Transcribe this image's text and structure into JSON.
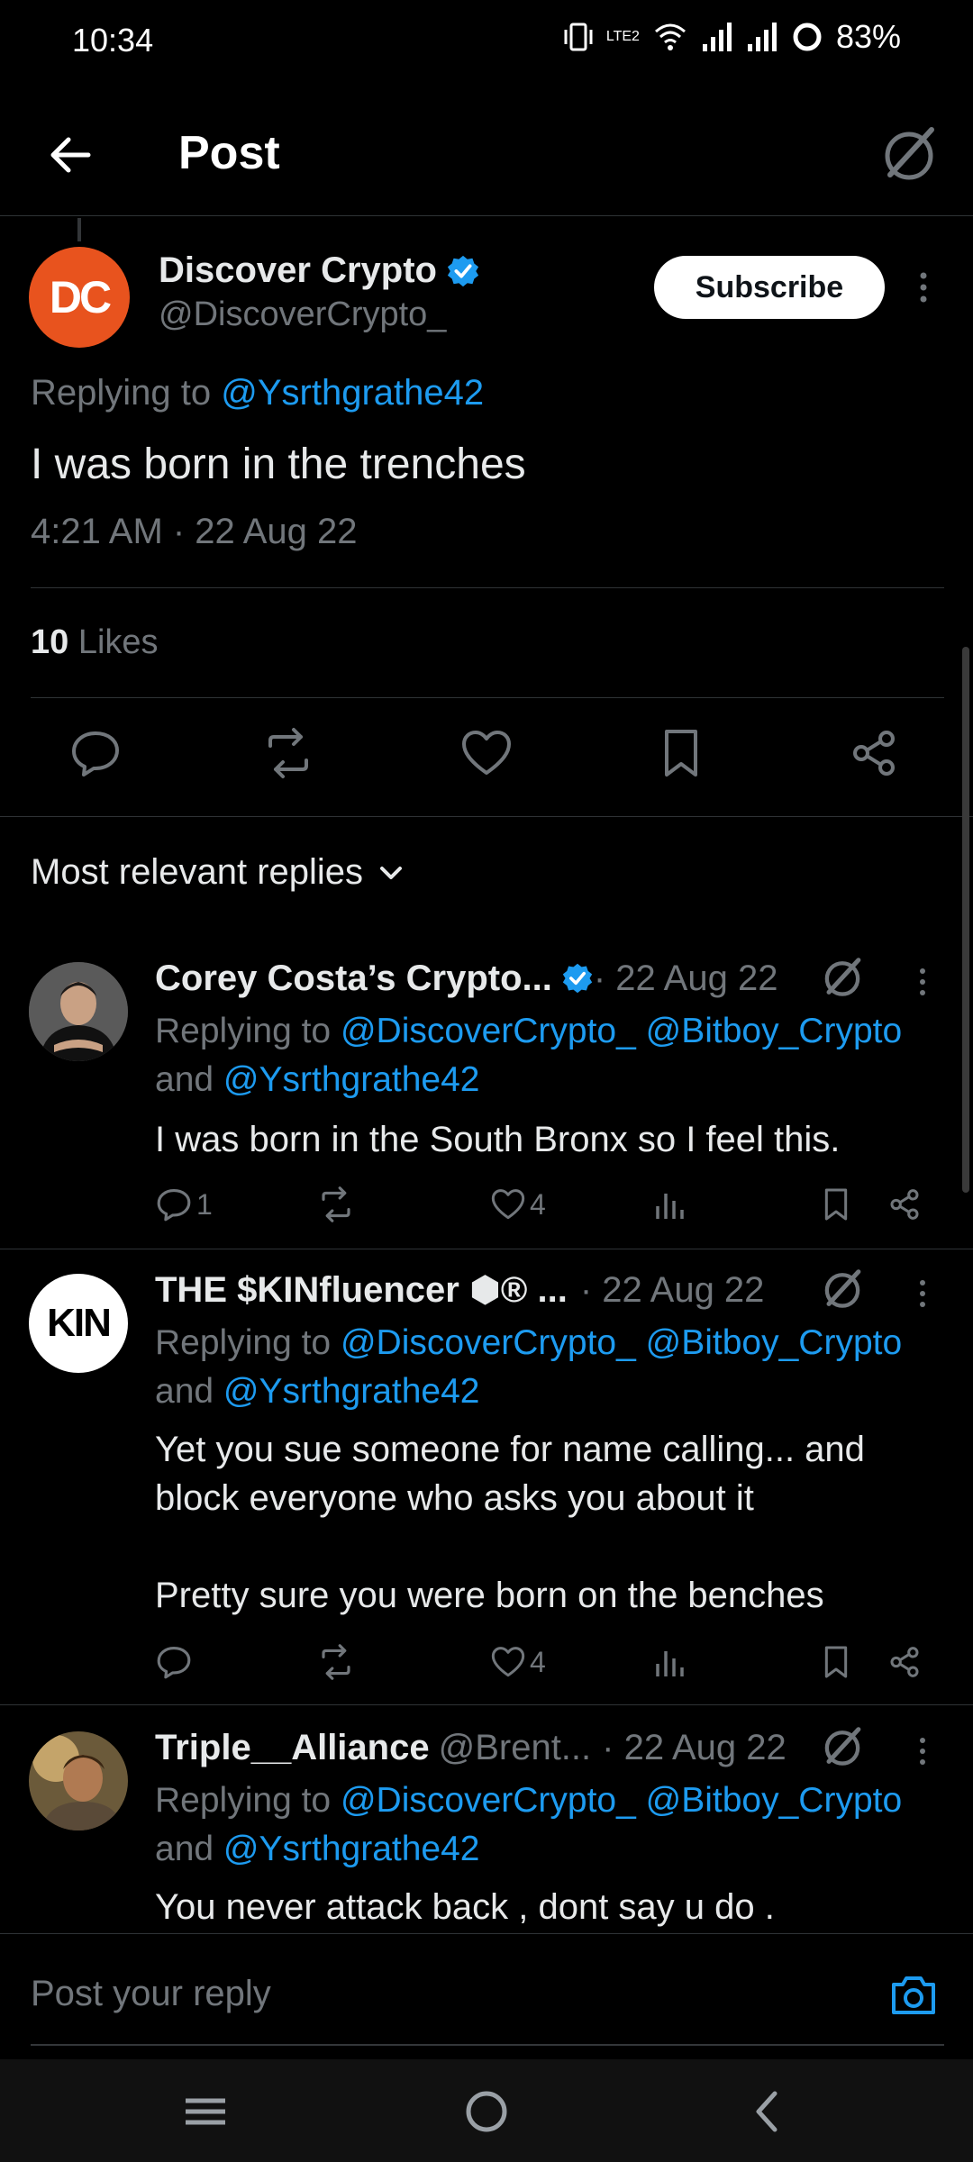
{
  "status_bar": {
    "time": "10:34",
    "network_label": "LTE2",
    "battery": "83%"
  },
  "header": {
    "title": "Post"
  },
  "main_post": {
    "avatar_text": "DC",
    "author_name": "Discover Crypto",
    "author_handle": "@DiscoverCrypto_",
    "subscribe_label": "Subscribe",
    "replying_prefix": "Replying to ",
    "replying_to": "@Ysrthgrathe42",
    "text": "I was born in the trenches",
    "timestamp": "4:21 AM · 22 Aug 22",
    "likes_count": "10",
    "likes_label": " Likes"
  },
  "sort": {
    "label": "Most relevant replies"
  },
  "replies": [
    {
      "name": "Corey Costa’s Crypto...",
      "sub": "",
      "date": " · 22 Aug 22",
      "verified": true,
      "replying_prefix": "Replying to ",
      "replying_handles": "@DiscoverCrypto_ @Bitboy_Crypto",
      "replying_and": "and ",
      "replying_last": "@Ysrthgrathe42",
      "body": "I was born in the South Bronx so I feel this.",
      "reply_count": "1",
      "like_count": "4"
    },
    {
      "name": "THE $KINfluencer ⬢® ...",
      "sub": "",
      "date": " · 22 Aug 22",
      "verified": false,
      "avatar_text": "KIN",
      "replying_prefix": "Replying to ",
      "replying_handles": "@DiscoverCrypto_ @Bitboy_Crypto",
      "replying_and": "and ",
      "replying_last": "@Ysrthgrathe42",
      "body_line1": "Yet you sue someone for name calling... and",
      "body_line2": "block everyone who asks you about it",
      "body_line3": "Pretty sure you were born on the benches",
      "reply_count": "",
      "like_count": "4"
    },
    {
      "name": "Triple__Alliance",
      "sub": "@Brent...",
      "date": " · 22 Aug 22",
      "verified": false,
      "replying_prefix": "Replying to ",
      "replying_handles": "@DiscoverCrypto_ @Bitboy_Crypto",
      "replying_and": "and ",
      "replying_last": "@Ysrthgrathe42",
      "body": "You never attack back , dont say u do ."
    }
  ],
  "composer": {
    "placeholder": "Post your reply"
  },
  "colors": {
    "accent": "#1d9bf0",
    "background": "#000000",
    "secondary_text": "#71767b",
    "avatar_dc": "#e8531e"
  },
  "icons": [
    "back-arrow-icon",
    "grok-icon",
    "verified-badge-icon",
    "more-icon",
    "reply-icon",
    "repost-icon",
    "like-icon",
    "bookmark-icon",
    "share-icon",
    "views-icon",
    "chevron-down-icon",
    "camera-icon",
    "menu-icon",
    "home-icon",
    "nav-back-icon"
  ]
}
